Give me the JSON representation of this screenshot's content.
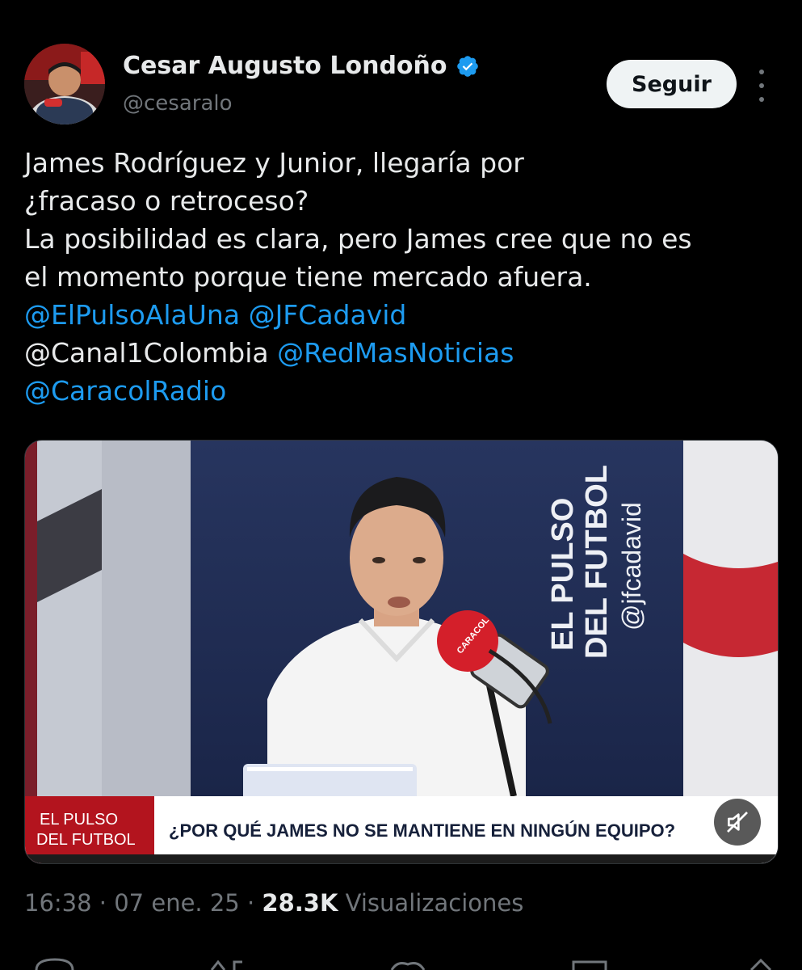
{
  "author": {
    "display_name": "Cesar Augusto Londoño",
    "handle": "@cesaralo",
    "verified": true
  },
  "follow_label": "Seguir",
  "tweet": {
    "line1": "James Rodríguez y Junior, llegaría por",
    "line2": "¿fracaso o retroceso?",
    "line3": "La posibilidad es clara, pero James cree que no es",
    "line4": "el momento porque tiene mercado afuera.",
    "mention1": "@ElPulsoAlaUna",
    "mention2": "@JFCadavid",
    "mention3": "@Canal1Colombia",
    "mention4": "@RedMasNoticias",
    "mention5": "@CaracolRadio"
  },
  "video": {
    "set_logo_line1": "EL PULSO",
    "set_logo_line2": "DEL FUTBOL",
    "set_handle": "@jfcadavid",
    "lower_third_logo_line1": "EL PULSO",
    "lower_third_logo_line2": "DEL FUTBOL",
    "headline": "¿POR QUÉ JAMES NO SE MANTIENE EN NINGÚN EQUIPO?"
  },
  "meta": {
    "time": "16:38",
    "sep1": "·",
    "date": "07 ene. 25",
    "sep2": "·",
    "views_count": "28.3K",
    "views_label": "Visualizaciones"
  },
  "colors": {
    "background": "#000000",
    "text": "#e7e9ea",
    "muted": "#71767b",
    "link": "#1d9bf0",
    "verified": "#1d9bf0"
  },
  "icons": {
    "verified": "verified-badge-icon",
    "more": "more-options-icon",
    "mute": "muted-speaker-icon"
  }
}
